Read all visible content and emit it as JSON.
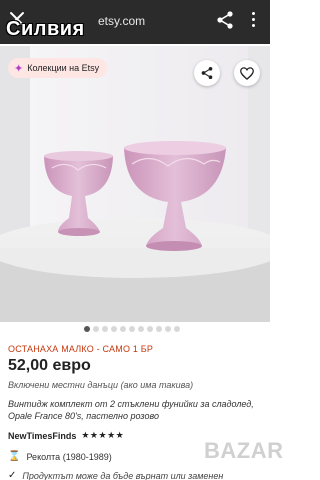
{
  "browser": {
    "url": "etsy.com",
    "watermark_text": "Силвия",
    "icons": {
      "close": "close-icon",
      "share": "share-icon",
      "menu": "more-vert-icon"
    }
  },
  "gallery": {
    "badge_label": "Колекции на Etsy",
    "icons": {
      "badge": "sparkle-icon",
      "share": "share-icon",
      "favorite": "heart-icon"
    },
    "slide_count": 11,
    "active_index": 0
  },
  "listing": {
    "stock_notice": "ОСТАНАХА МАЛКО - САМО 1 БР",
    "price": "52,00 евро",
    "tax_note": "Включени местни данъци (ако има такива)",
    "title": "Винтидж комплект от 2 стъклени фунийки за сладолед, Opale France 80's, пастелно розово",
    "shop_name": "NewTimesFinds",
    "rating_stars": "★★★★★",
    "rating_value": 4.5,
    "attribute": "Реколта (1980-1989)",
    "return_note": "Продуктът може да бъде върнат или заменен",
    "watermark_logo": "Bazar"
  },
  "colors": {
    "browser_bar": "#2b2b2b",
    "stock_notice": "#c4380f",
    "badge_bg": "#fde6e3",
    "glass": "#d7a9c9"
  }
}
